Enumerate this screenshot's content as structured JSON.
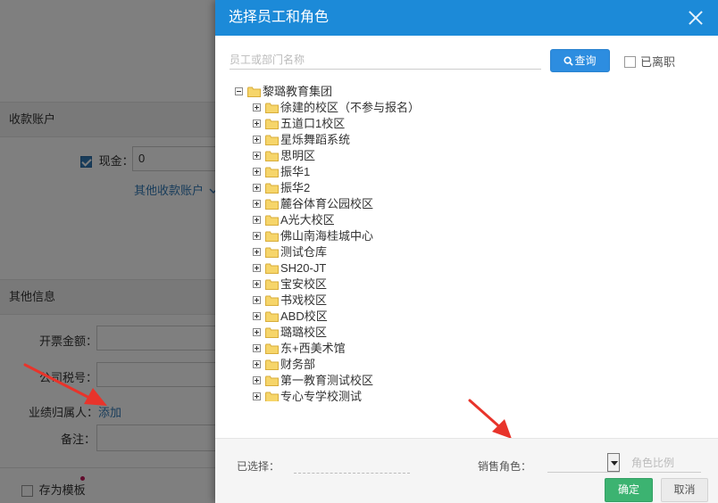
{
  "background": {
    "receipt_section_title": "收款账户",
    "cash_label": "现金：",
    "cash_value": "0",
    "other_accounts_link": "其他收款账户",
    "other_info_title": "其他信息",
    "invoice_amount_label": "开票金额：",
    "tax_id_label": "公司税号：",
    "performance_owner_label": "业绩归属人：",
    "add_link": "添加",
    "remark_label": "备注：",
    "save_template_label": "存为模板"
  },
  "modal": {
    "title": "选择员工和角色",
    "search_placeholder": "员工或部门名称",
    "search_button": "查询",
    "left_checkbox_label": "已离职",
    "tree": {
      "root": "黎璐教育集团",
      "children": [
        "徐建的校区（不参与报名）",
        "五道口1校区",
        "星烁舞蹈系统",
        "思明区",
        "振华1",
        "振华2",
        "麓谷体育公园校区",
        "A光大校区",
        "佛山南海桂城中心",
        "测试仓库",
        "SH20-JT",
        "宝安校区",
        "书戏校区",
        "ABD校区",
        "璐璐校区",
        "东+西美术馆",
        "财务部",
        "第一教育测试校区",
        "专心专学校测试"
      ]
    },
    "selected_label": "已选择：",
    "sales_role_label": "销售角色：",
    "role_ratio_placeholder": "角色比例",
    "confirm_button": "确定",
    "cancel_button": "取消"
  },
  "colors": {
    "header_blue": "#1c8ad8",
    "search_button_blue": "#2d8de0",
    "confirm_green": "#3cb371",
    "arrow_red": "#e8342b",
    "folder_yellow": "#f6d56a"
  },
  "icons": {
    "close": "close-icon",
    "search": "search-icon",
    "folder": "folder-icon",
    "expand": "plus-box-icon",
    "collapse": "minus-box-icon",
    "chevron": "chevron-down-icon"
  }
}
